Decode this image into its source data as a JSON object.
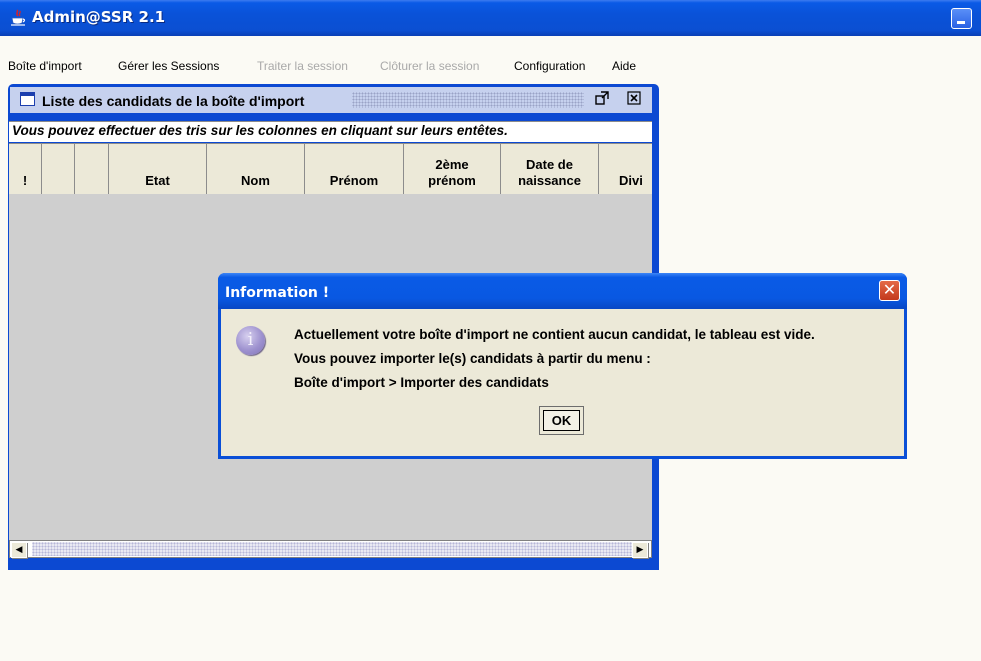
{
  "window": {
    "title": "Admin@SSR 2.1",
    "icon": "java-cup-icon"
  },
  "menubar": {
    "items": [
      {
        "label": "Boîte d'import",
        "enabled": true
      },
      {
        "label": "Gérer les Sessions",
        "enabled": true
      },
      {
        "label": "Traiter la session",
        "enabled": false
      },
      {
        "label": "Clôturer la session",
        "enabled": false
      },
      {
        "label": "Configuration",
        "enabled": true
      },
      {
        "label": "Aide",
        "enabled": true
      }
    ]
  },
  "internal_frame": {
    "title": "Liste des candidats de la boîte d'import",
    "hint": "Vous pouvez effectuer des tris sur les colonnes en cliquant sur leurs entêtes.",
    "columns": [
      "!",
      "",
      "",
      "Etat",
      "Nom",
      "Prénom",
      "2ème\nprénom",
      "Date de\nnaissance",
      "Divi"
    ]
  },
  "dialog": {
    "title": "Information !",
    "lines": [
      "Actuellement votre boîte d'import ne contient aucun candidat, le tableau est vide.",
      "Vous pouvez importer le(s) candidats à partir du menu :",
      "Boîte d'import > Importer des candidats"
    ],
    "ok_label": "OK",
    "icon_glyph": "i"
  }
}
